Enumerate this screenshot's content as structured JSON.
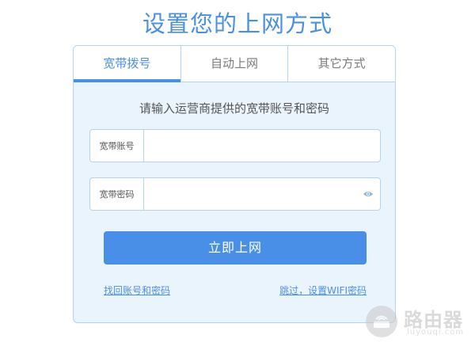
{
  "page": {
    "title": "设置您的上网方式"
  },
  "tabs": [
    {
      "label": "宽带拨号",
      "active": true
    },
    {
      "label": "自动上网",
      "active": false
    },
    {
      "label": "其它方式",
      "active": false
    }
  ],
  "form": {
    "prompt": "请输入运营商提供的宽带账号和密码",
    "account_label": "宽带账号",
    "account_value": "",
    "password_label": "宽带密码",
    "password_value": "",
    "submit_label": "立即上网",
    "recover_link": "找回账号和密码",
    "skip_link": "跳过，设置WIFI密码"
  },
  "watermark": {
    "brand": "路由器",
    "sub": "luyouqi.com"
  },
  "colors": {
    "accent": "#4a90e2",
    "button": "#4a8fe7",
    "panel_bg": "#eaf4fd",
    "border": "#b3d3ef"
  },
  "icons": {
    "password_toggle": "eye-icon",
    "watermark_logo": "router-logo-icon"
  }
}
